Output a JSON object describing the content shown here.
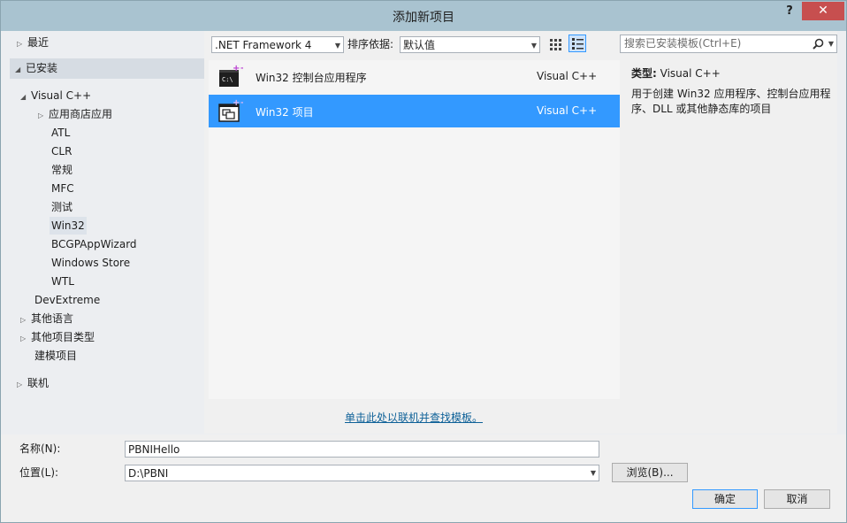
{
  "window": {
    "title": "添加新项目",
    "help": "?",
    "close": "✕"
  },
  "tree": {
    "recent": "最近",
    "installed": "已安装",
    "visual_cpp": "Visual C++",
    "children": [
      "应用商店应用",
      "ATL",
      "CLR",
      "常规",
      "MFC",
      "测试",
      "Win32",
      "BCGPAppWizard",
      "Windows Store",
      "WTL"
    ],
    "devextreme": "DevExtreme",
    "other_languages": "其他语言",
    "other_project_types": "其他项目类型",
    "modeling": "建模项目",
    "online": "联机"
  },
  "toolbar": {
    "framework": ".NET Framework 4",
    "sort_label": "排序依据:",
    "sort_value": "默认值",
    "search_placeholder": "搜索已安装模板(Ctrl+E)"
  },
  "templates": [
    {
      "name": "Win32 控制台应用程序",
      "lang": "Visual C++",
      "icon": "console-app-icon",
      "selected": false
    },
    {
      "name": "Win32 项目",
      "lang": "Visual C++",
      "icon": "win32-project-icon",
      "selected": true
    }
  ],
  "info": {
    "type_label": "类型:",
    "type_value": "Visual C++",
    "description": "用于创建 Win32 应用程序、控制台应用程序、DLL 或其他静态库的项目"
  },
  "online_link": "单击此处以联机并查找模板。",
  "form": {
    "name_label": "名称(N):",
    "name_value": "PBNIHello",
    "location_label": "位置(L):",
    "location_value": "D:\\PBNI",
    "browse": "浏览(B)...",
    "ok": "确定",
    "cancel": "取消"
  },
  "colors": {
    "selection": "#3399ff",
    "titlebar": "#a9c3d0",
    "close": "#c74f4f",
    "link": "#0e6198"
  }
}
